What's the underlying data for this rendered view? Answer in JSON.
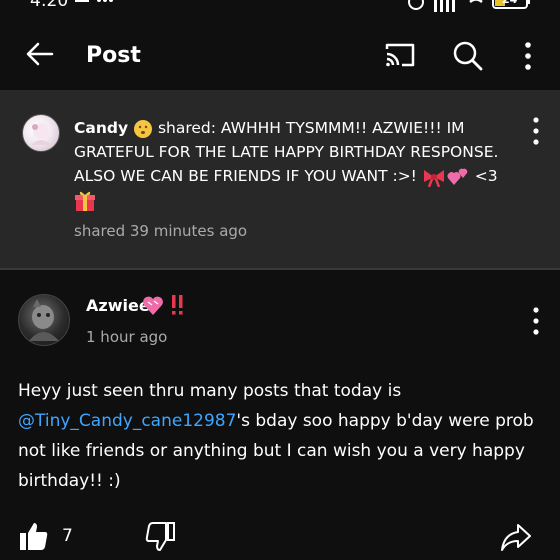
{
  "status_bar": {
    "time": "4:20",
    "battery": "24"
  },
  "app_bar": {
    "title": "Post"
  },
  "shared_post": {
    "name": "Candy",
    "text_line1_rest": " shared: AWHHH TYSMMM!! AZWIE!!! IM",
    "text_line2": "GRATEFUL FOR THE LATE HAPPY BIRTHDAY RESPONSE.",
    "text_line3": "ALSO WE CAN BE FRIENDS IF YOU WANT :>! ",
    "text_line3_end": " <3",
    "time": "shared 39 minutes ago"
  },
  "post": {
    "author": "Azwiee",
    "time": "1 hour ago",
    "body_before": "Heyy just seen thru many posts that today is ",
    "mention": "@Tiny_Candy_cane12987",
    "body_after": "'s bday soo happy b'day were prob not like friends or anything but I can wish you a very happy birthday!! :)",
    "like_count": "7"
  },
  "icons": {
    "back": "arrow-left-icon",
    "cast": "cast-icon",
    "search": "search-icon",
    "more": "more-vert-icon",
    "like": "thumbs-up-icon",
    "dislike": "thumbs-down-icon",
    "share": "share-icon"
  },
  "colors": {
    "background": "#0f0f0f",
    "shared_card": "#282828",
    "mention": "#3ea6ff",
    "secondary_text": "#aaaaaa"
  }
}
